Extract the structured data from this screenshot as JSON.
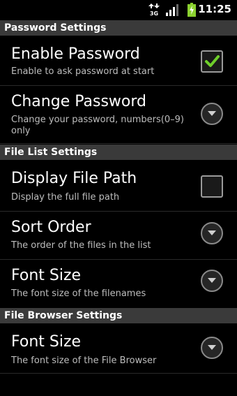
{
  "status_bar": {
    "network": "3G",
    "time": "11:25"
  },
  "sections": {
    "password": "Password Settings",
    "file_list": "File List Settings",
    "file_browser": "File Browser Settings"
  },
  "items": {
    "enable_password": {
      "title": "Enable Password",
      "summary": "Enable to ask password at start",
      "checked": true
    },
    "change_password": {
      "title": "Change Password",
      "summary": "Change your password, numbers(0–9) only"
    },
    "display_file_path": {
      "title": "Display File Path",
      "summary": "Display the full file path",
      "checked": false
    },
    "sort_order": {
      "title": "Sort Order",
      "summary": "The order of the files in the list"
    },
    "font_size_list": {
      "title": "Font Size",
      "summary": "The font size of the filenames"
    },
    "font_size_browser": {
      "title": "Font Size",
      "summary": "The font size of the File Browser"
    }
  },
  "colors": {
    "section_bg": "#3a3a3a",
    "check_green": "#6fcf2a",
    "battery_green": "#8bd12f"
  }
}
